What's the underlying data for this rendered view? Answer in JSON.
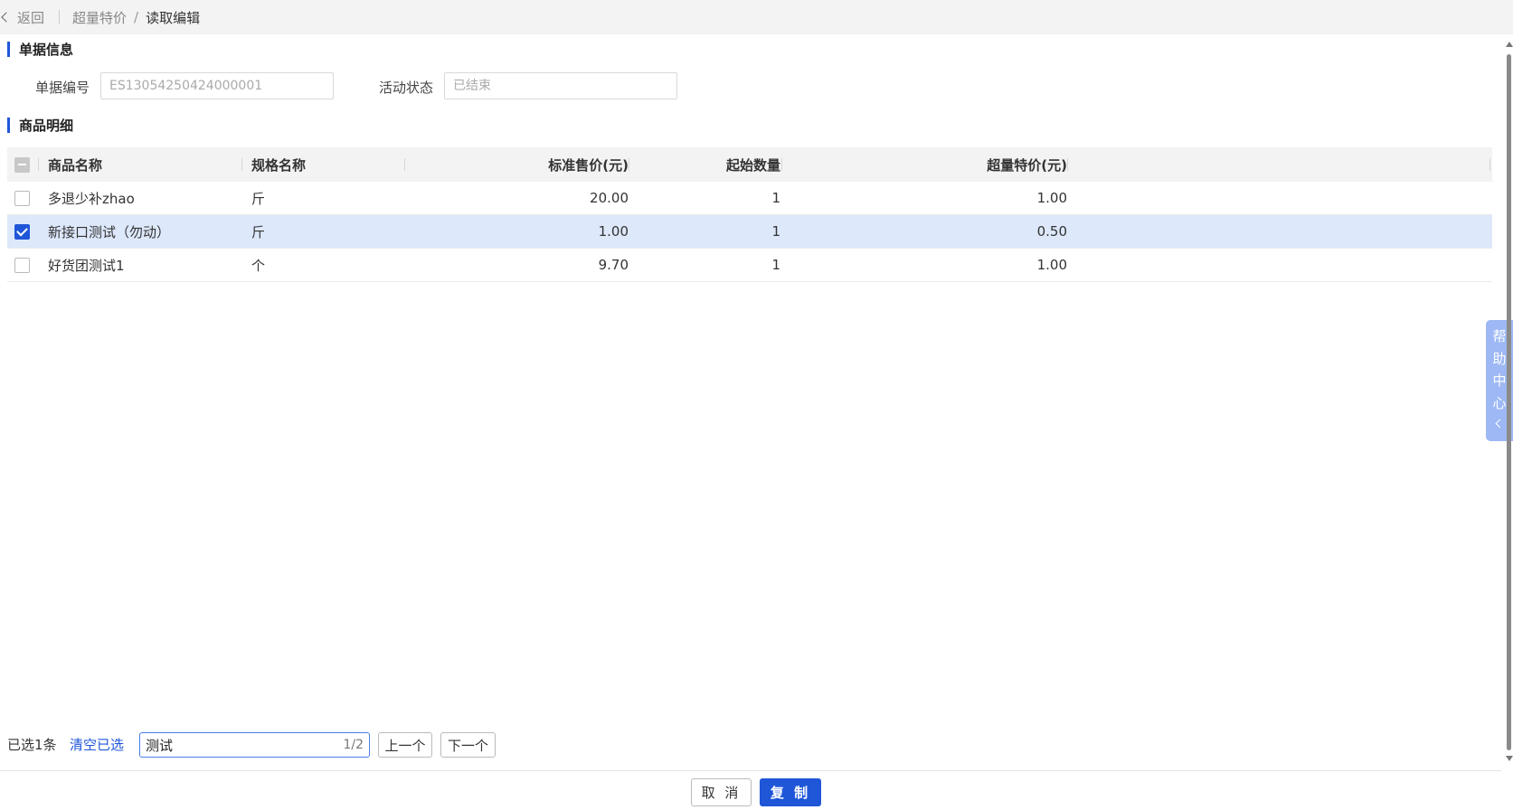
{
  "header": {
    "back_label": "返回",
    "breadcrumb_parent": "超量特价",
    "breadcrumb_separator": "/",
    "breadcrumb_current": "读取编辑"
  },
  "doc_info": {
    "section_title": "单据信息",
    "doc_no_label": "单据编号",
    "doc_no_value": "ES13054250424000001",
    "status_label": "活动状态",
    "status_value": "已结束"
  },
  "items": {
    "section_title": "商品明细",
    "columns": [
      "商品名称",
      "规格名称",
      "标准售价(元)",
      "起始数量",
      "超量特价(元)"
    ],
    "rows": [
      {
        "name": "多退少补zhao",
        "spec": "斤",
        "price": "20.00",
        "qty": "1",
        "special": "1.00",
        "checked": false
      },
      {
        "name": "新接口测试（勿动）",
        "spec": "斤",
        "price": "1.00",
        "qty": "1",
        "special": "0.50",
        "checked": true
      },
      {
        "name": "好货团测试1",
        "spec": "个",
        "price": "9.70",
        "qty": "1",
        "special": "1.00",
        "checked": false
      }
    ]
  },
  "footer": {
    "selected_count": "已选1条",
    "clear_label": "清空已选",
    "search_value": "测试",
    "search_count": "1/2",
    "prev_label": "上一个",
    "next_label": "下一个"
  },
  "actions": {
    "cancel_label": "取 消",
    "copy_label": "复 制"
  },
  "help": {
    "chars": [
      "帮",
      "助",
      "中",
      "心"
    ]
  },
  "colors": {
    "accent": "#1f56d8",
    "selected_row": "#dde8fb",
    "help_tab": "#9db8f4"
  }
}
